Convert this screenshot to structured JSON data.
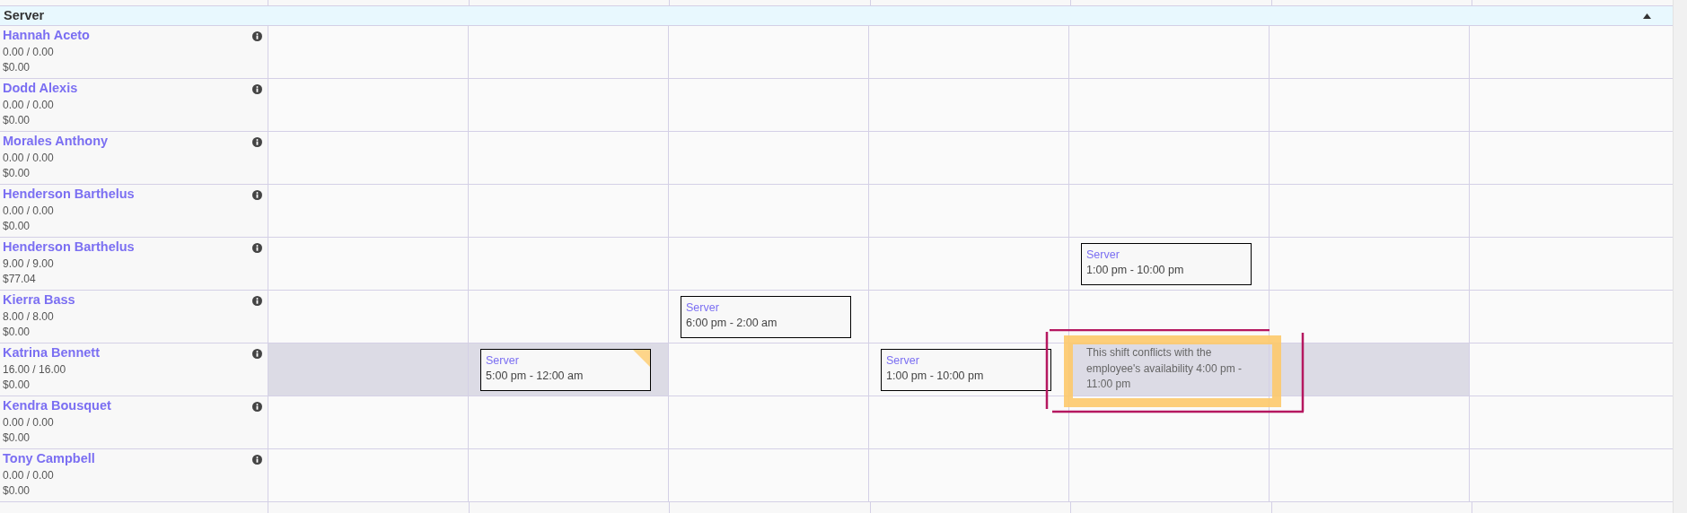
{
  "section": {
    "title": "Server",
    "expanded": true
  },
  "rows": [
    {
      "name": "Hannah Aceto",
      "hours": "0.00 / 0.00",
      "cost": "$0.00",
      "days": [
        {
          "highlighted": false
        },
        {
          "highlighted": false
        },
        {
          "highlighted": false
        },
        {
          "highlighted": false
        },
        {
          "highlighted": false
        },
        {
          "highlighted": false
        },
        {
          "highlighted": false
        }
      ]
    },
    {
      "name": "Dodd Alexis",
      "hours": "0.00 / 0.00",
      "cost": "$0.00",
      "days": [
        {
          "highlighted": false
        },
        {
          "highlighted": false
        },
        {
          "highlighted": false
        },
        {
          "highlighted": false
        },
        {
          "highlighted": false
        },
        {
          "highlighted": false
        },
        {
          "highlighted": false
        }
      ]
    },
    {
      "name": "Morales Anthony",
      "hours": "0.00 / 0.00",
      "cost": "$0.00",
      "days": [
        {
          "highlighted": false
        },
        {
          "highlighted": false
        },
        {
          "highlighted": false
        },
        {
          "highlighted": false
        },
        {
          "highlighted": false
        },
        {
          "highlighted": false
        },
        {
          "highlighted": false
        }
      ]
    },
    {
      "name": "Henderson Barthelus",
      "hours": "0.00 / 0.00",
      "cost": "$0.00",
      "days": [
        {
          "highlighted": false
        },
        {
          "highlighted": false
        },
        {
          "highlighted": false
        },
        {
          "highlighted": false
        },
        {
          "highlighted": false
        },
        {
          "highlighted": false
        },
        {
          "highlighted": false
        }
      ]
    },
    {
      "name": "Henderson Barthelus",
      "hours": "9.00 / 9.00",
      "cost": "$77.04",
      "days": [
        {
          "highlighted": false
        },
        {
          "highlighted": false
        },
        {
          "highlighted": false
        },
        {
          "highlighted": false
        },
        {
          "highlighted": false,
          "shift": {
            "role": "Server",
            "time": "1:00 pm - 10:00 pm",
            "flagged": false
          }
        },
        {
          "highlighted": false
        },
        {
          "highlighted": false
        }
      ]
    },
    {
      "name": "Kierra Bass",
      "hours": "8.00 / 8.00",
      "cost": "$0.00",
      "days": [
        {
          "highlighted": false
        },
        {
          "highlighted": false
        },
        {
          "highlighted": false,
          "shift": {
            "role": "Server",
            "time": "6:00 pm - 2:00 am",
            "flagged": false
          }
        },
        {
          "highlighted": false
        },
        {
          "highlighted": false
        },
        {
          "highlighted": false
        },
        {
          "highlighted": false
        }
      ]
    },
    {
      "name": "Katrina Bennett",
      "hours": "16.00 / 16.00",
      "cost": "$0.00",
      "days": [
        {
          "highlighted": true
        },
        {
          "highlighted": true,
          "shift": {
            "role": "Server",
            "time": "5:00 pm - 12:00 am",
            "flagged": true
          }
        },
        {
          "highlighted": false
        },
        {
          "highlighted": false,
          "shift": {
            "role": "Server",
            "time": "1:00 pm - 10:00 pm",
            "flagged": false
          }
        },
        {
          "highlighted": true,
          "conflict": "This shift conflicts with the employee's availability 4:00 pm - 11:00 pm"
        },
        {
          "highlighted": true
        },
        {
          "highlighted": false
        }
      ]
    },
    {
      "name": "Kendra Bousquet",
      "hours": "0.00 / 0.00",
      "cost": "$0.00",
      "days": [
        {
          "highlighted": false
        },
        {
          "highlighted": false
        },
        {
          "highlighted": false
        },
        {
          "highlighted": false
        },
        {
          "highlighted": false
        },
        {
          "highlighted": false
        },
        {
          "highlighted": false
        }
      ]
    },
    {
      "name": "Tony Campbell",
      "hours": "0.00 / 0.00",
      "cost": "$0.00",
      "days": [
        {
          "highlighted": false
        },
        {
          "highlighted": false
        },
        {
          "highlighted": false
        },
        {
          "highlighted": false
        },
        {
          "highlighted": false
        },
        {
          "highlighted": false
        },
        {
          "highlighted": false
        }
      ]
    }
  ]
}
